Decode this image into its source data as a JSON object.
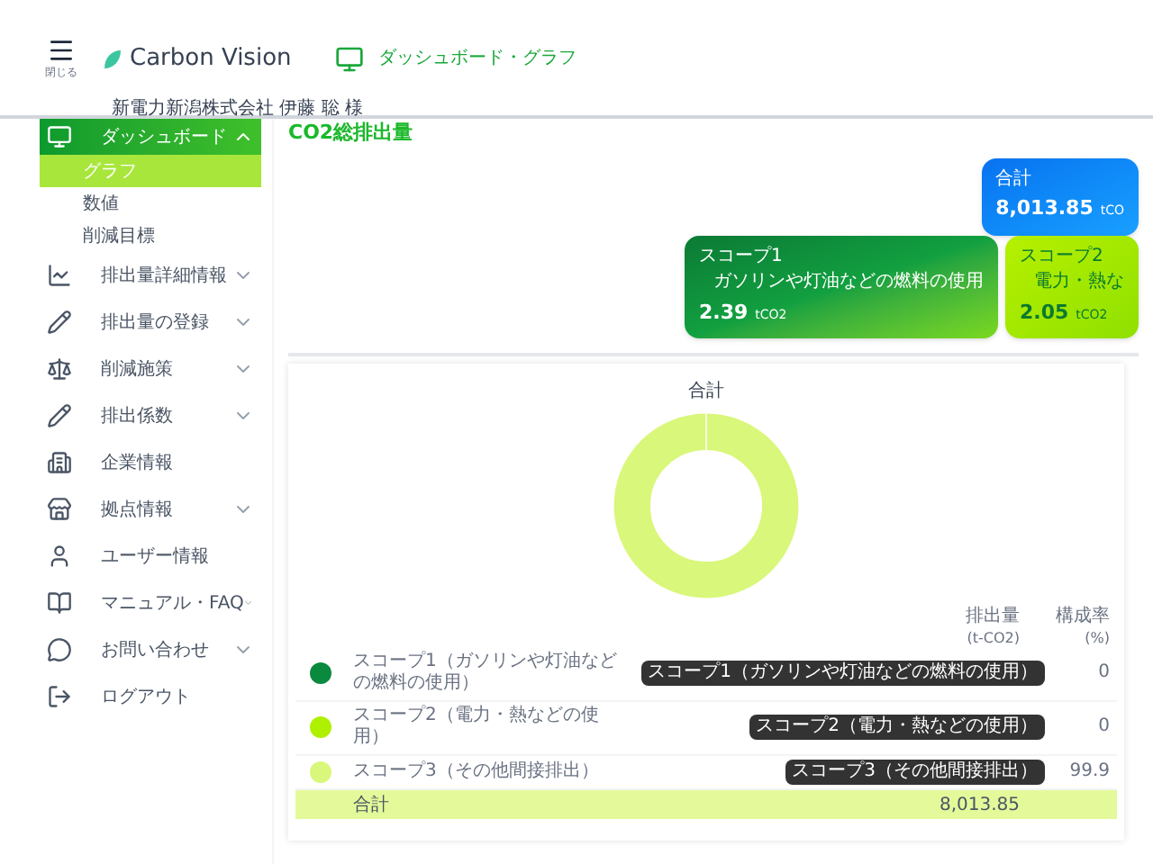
{
  "header": {
    "menu_label": "閉じる",
    "brand": "Carbon Vision",
    "breadcrumb": "ダッシュボード・グラフ",
    "user": "新電力新潟株式会社 伊藤 聡 様"
  },
  "sidebar": {
    "items": [
      {
        "label": "ダッシュボード",
        "kind": "group",
        "expanded": true,
        "selected": true,
        "children": [
          {
            "label": "グラフ",
            "selected": true
          },
          {
            "label": "数値",
            "selected": false
          },
          {
            "label": "削減目標",
            "selected": false
          }
        ]
      },
      {
        "label": "排出量詳細情報",
        "kind": "group",
        "expanded": false,
        "selected": false
      },
      {
        "label": "排出量の登録",
        "kind": "group",
        "expanded": false,
        "selected": false
      },
      {
        "label": "削減施策",
        "kind": "group",
        "expanded": false,
        "selected": false
      },
      {
        "label": "排出係数",
        "kind": "group",
        "expanded": false,
        "selected": false
      },
      {
        "label": "企業情報",
        "kind": "link",
        "selected": false
      },
      {
        "label": "拠点情報",
        "kind": "group",
        "expanded": false,
        "selected": false
      },
      {
        "label": "ユーザー情報",
        "kind": "link",
        "selected": false
      },
      {
        "label": "マニュアル・FAQ",
        "kind": "group",
        "expanded": false,
        "selected": false
      },
      {
        "label": "お問い合わせ",
        "kind": "group",
        "expanded": false,
        "selected": false
      },
      {
        "label": "ログアウト",
        "kind": "link",
        "selected": false
      }
    ]
  },
  "page_title": "CO2総排出量",
  "cards": [
    {
      "kind": "total",
      "title": "合計",
      "value": "8,013.85",
      "unit": "tCO"
    },
    {
      "kind": "scope1",
      "title": "スコープ1",
      "subtitle": "ガソリンや灯油などの燃料の使用",
      "value": "2.39",
      "unit": "tCO2"
    },
    {
      "kind": "scope2",
      "title": "スコープ2",
      "subtitle": "電力・熱な",
      "value": "2.05",
      "unit": "tCO2"
    }
  ],
  "chart_panel": {
    "title": "合計",
    "columns": [
      "排出量",
      "構成率"
    ],
    "column_units": [
      "(t-CO2)",
      "(%)"
    ],
    "rows": [
      {
        "color": "#0a8a3e",
        "label": "スコープ1（ガソリンや灯油などの燃料の使用）",
        "tooltip": "スコープ1（ガソリンや灯油などの燃料の使用）",
        "share": "0"
      },
      {
        "color": "#aef000",
        "label": "スコープ2（電力・熱などの使用）",
        "tooltip": "スコープ2（電力・熱などの使用）",
        "share": "0"
      },
      {
        "color": "#d9f77a",
        "label": "スコープ3（その他間接排出）",
        "tooltip": "スコープ3（その他間接排出）",
        "share": "99.9"
      }
    ],
    "total": {
      "label": "合計",
      "value": "8,013.85"
    }
  }
}
